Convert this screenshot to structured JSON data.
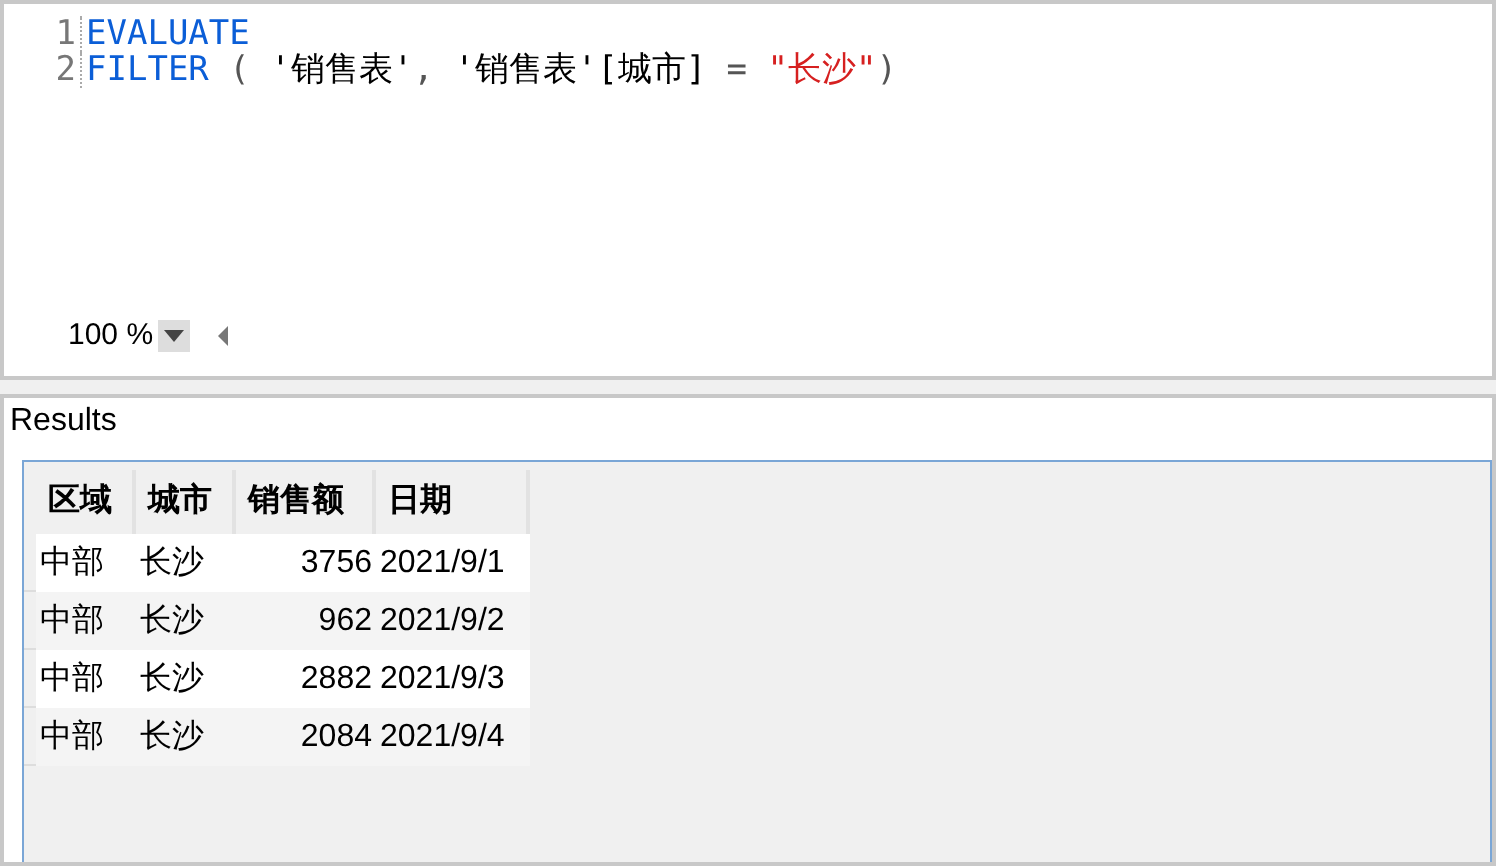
{
  "editor": {
    "lines": [
      {
        "number": "1",
        "tokens": [
          {
            "kind": "keyword",
            "text": "EVALUATE"
          }
        ]
      },
      {
        "number": "2",
        "tokens": [
          {
            "kind": "keyword",
            "text": "FILTER"
          },
          {
            "kind": "plain",
            "text": " ( "
          },
          {
            "kind": "text",
            "text": "'销售表'"
          },
          {
            "kind": "plain",
            "text": ", "
          },
          {
            "kind": "text",
            "text": "'销售表'[城市]"
          },
          {
            "kind": "plain",
            "text": " = "
          },
          {
            "kind": "string",
            "text": "\"长沙\""
          },
          {
            "kind": "plain",
            "text": ")"
          }
        ]
      }
    ],
    "zoom": "100 %"
  },
  "results": {
    "title": "Results",
    "columns": [
      "区域",
      "城市",
      "销售额",
      "日期"
    ],
    "rows": [
      [
        "中部",
        "长沙",
        "3756",
        "2021/9/1"
      ],
      [
        "中部",
        "长沙",
        "962",
        "2021/9/2"
      ],
      [
        "中部",
        "长沙",
        "2882",
        "2021/9/3"
      ],
      [
        "中部",
        "长沙",
        "2084",
        "2021/9/4"
      ]
    ]
  }
}
